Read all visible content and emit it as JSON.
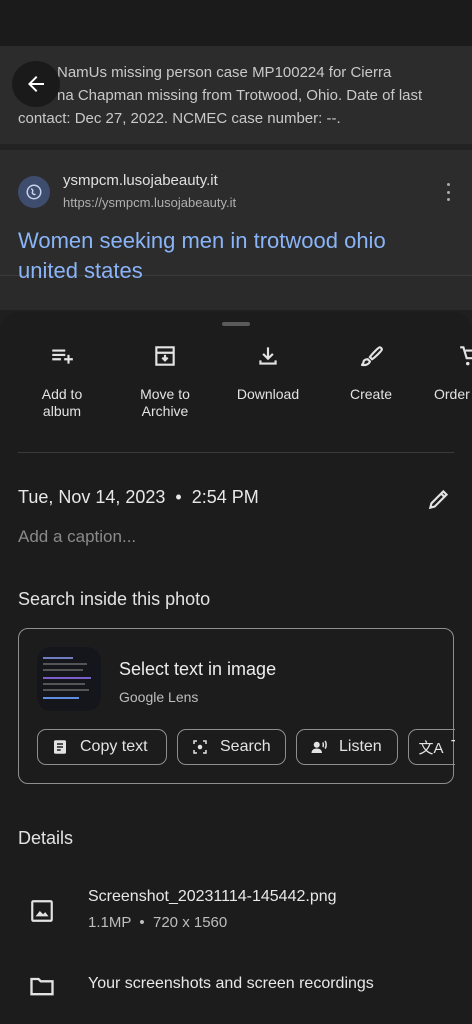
{
  "photo": {
    "snippet_text": "NamUs missing person case MP100224 for Cierra ... Chapman missing from Trotwood, Ohio. Date of last contact: Dec 27, 2022. NCMEC case number: --.",
    "snippet_line1": "NamUs missing person case MP100224 for Cierra",
    "snippet_line2": "na Chapman missing from Trotwood, Ohio. Date of last",
    "snippet_line3": "contact: Dec 27, 2022. NCMEC case number: --.",
    "site_name": "ysmpcm.lusojabeauty.it",
    "site_url": "https://ysmpcm.lusojabeauty.it",
    "result_title": "Women seeking men in trotwood ohio united states"
  },
  "actions": [
    {
      "label": "Add to album",
      "icon": "playlist-add-icon"
    },
    {
      "label": "Move to Archive",
      "icon": "archive-icon"
    },
    {
      "label": "Download",
      "icon": "download-icon"
    },
    {
      "label": "Create",
      "icon": "brush-icon"
    },
    {
      "label": "Order",
      "icon": "cart-icon"
    }
  ],
  "info": {
    "datetime": "Tue, Nov 14, 2023  •  2:54 PM",
    "caption_placeholder": "Add a caption..."
  },
  "search": {
    "title": "Search inside this photo",
    "lens_title": "Select text in image",
    "lens_sub": "Google Lens",
    "chips": [
      "Copy text",
      "Search",
      "Listen",
      "T"
    ]
  },
  "details": {
    "title": "Details",
    "file_name": "Screenshot_20231114-145442.png",
    "file_meta": "1.1MP  •  720 x 1560",
    "folder": "Your screenshots and screen recordings"
  },
  "colors": {
    "link": "#8ab4f8",
    "sheet_bg": "#1c1c1c"
  }
}
